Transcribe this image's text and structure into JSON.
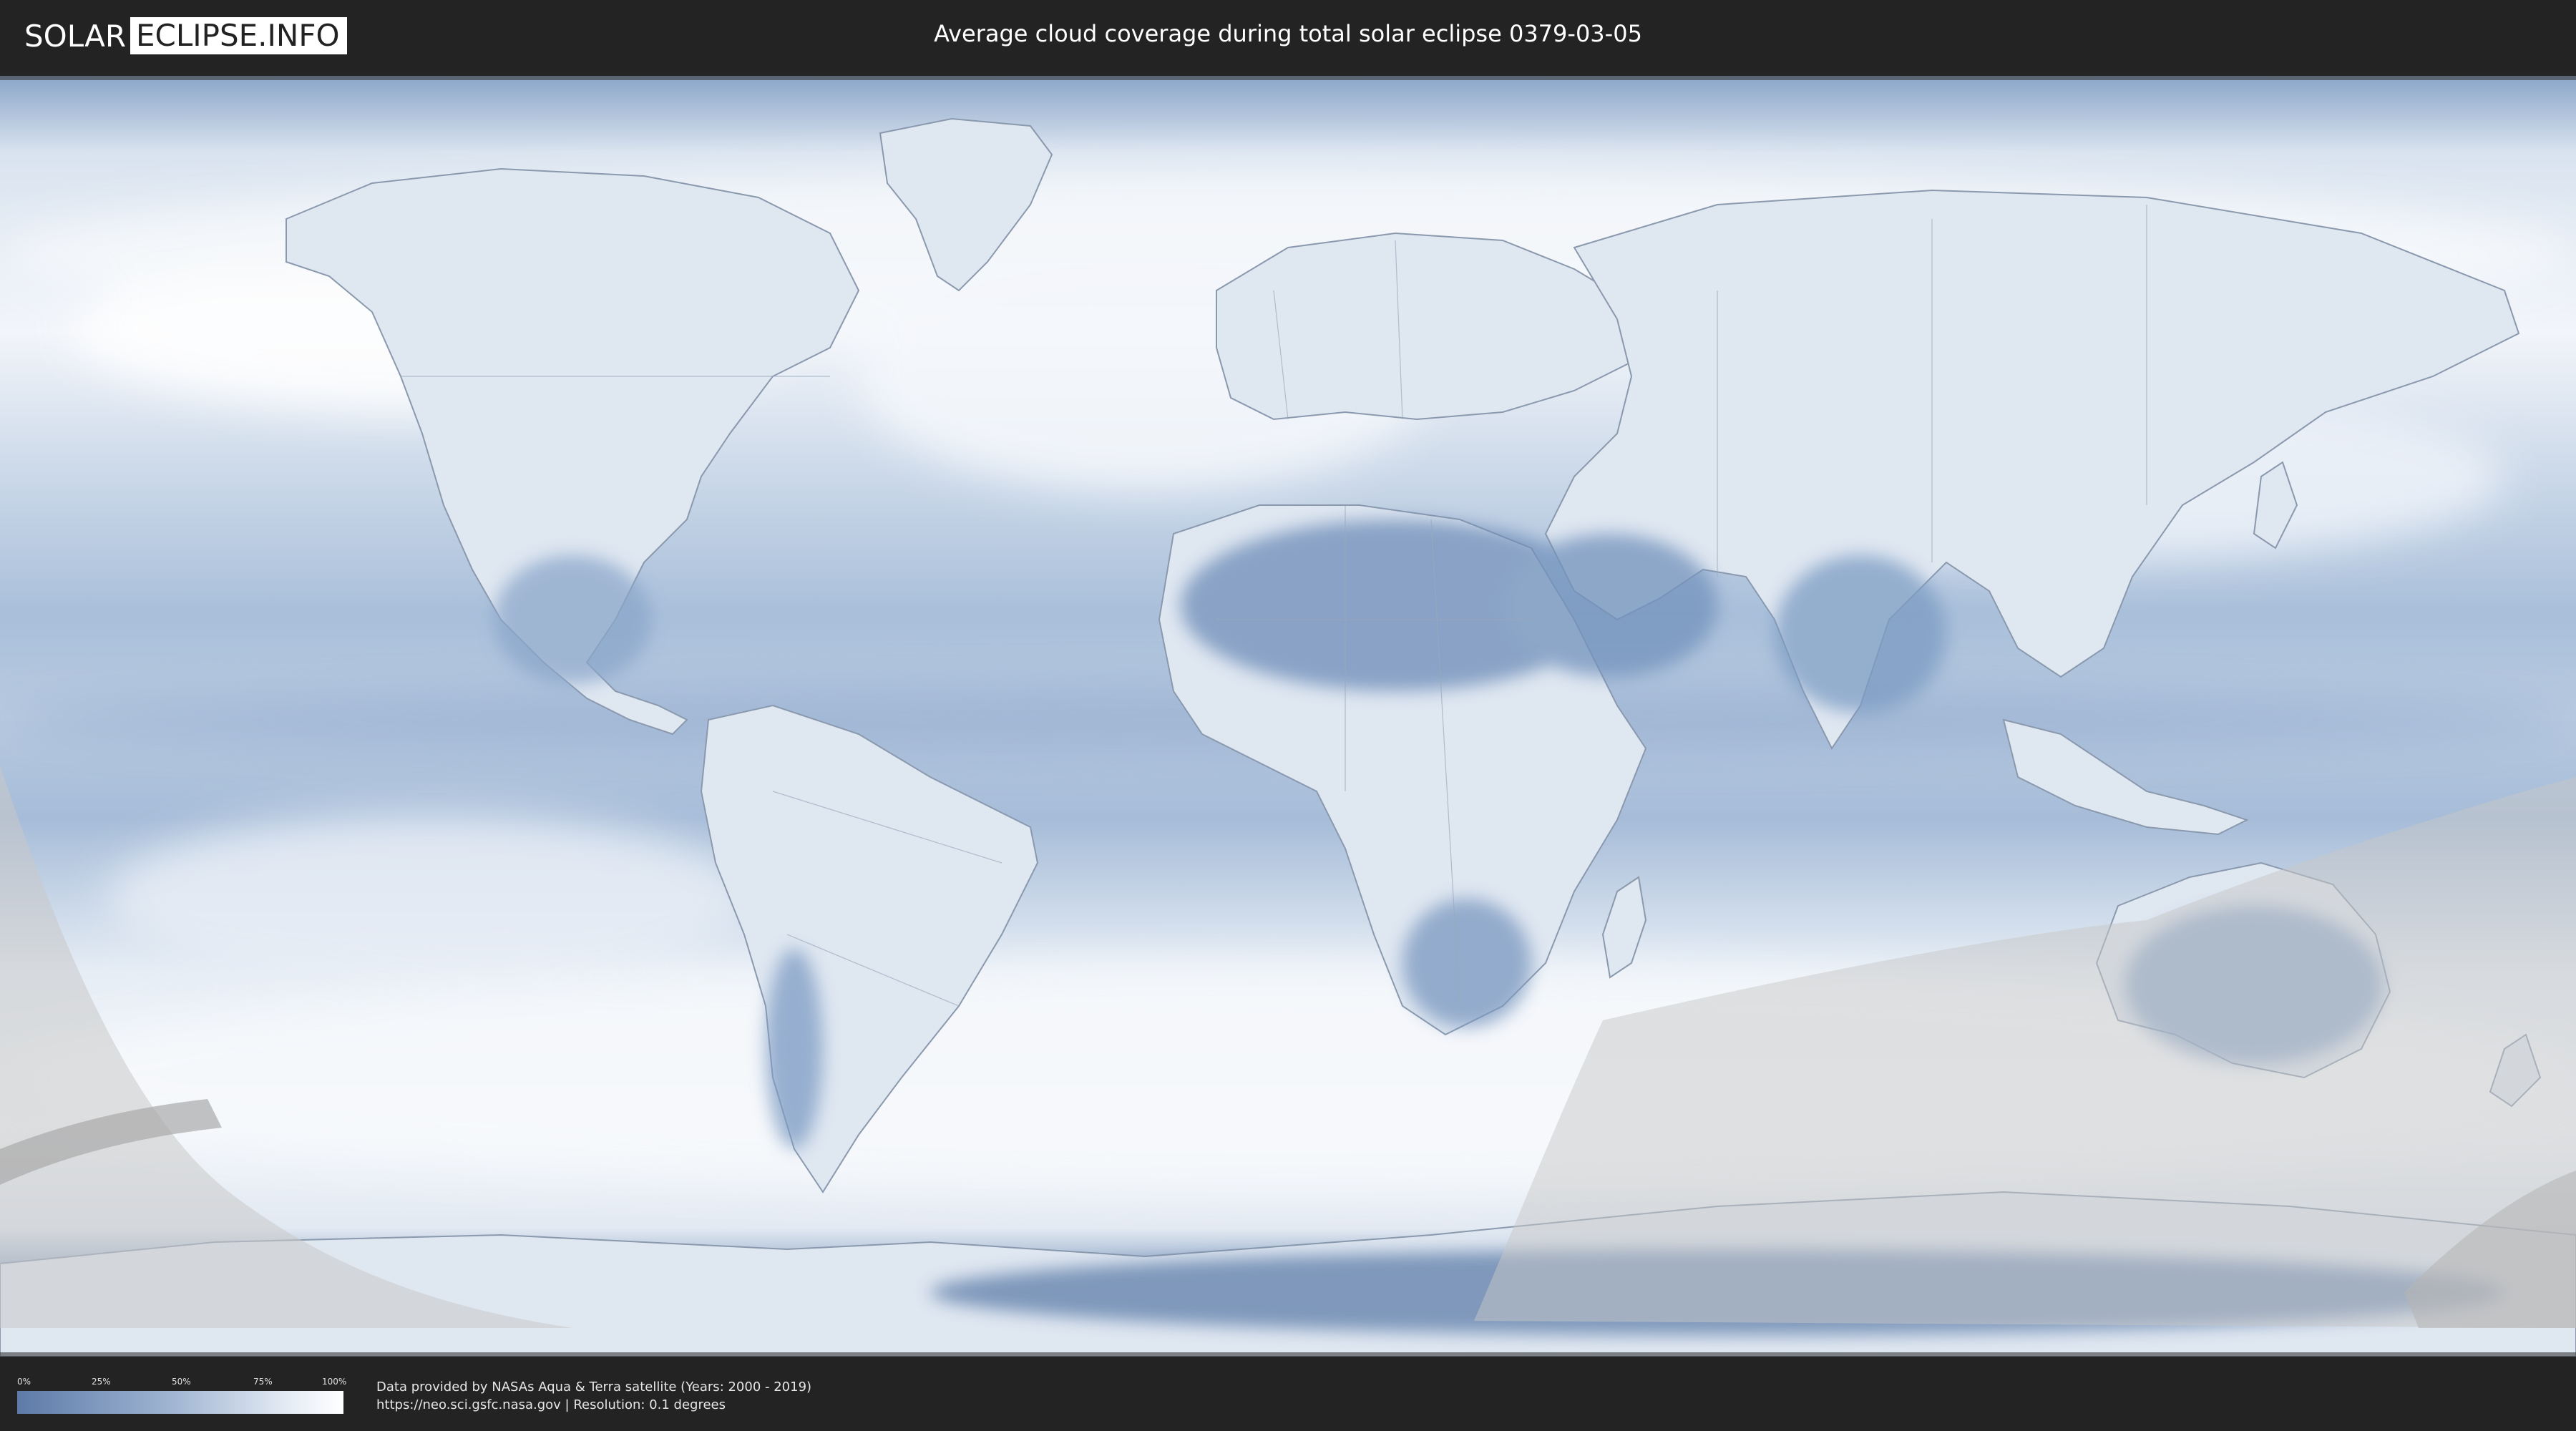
{
  "header": {
    "logo_left": "SOLAR",
    "logo_right": "ECLIPSE.INFO",
    "title": "Average cloud coverage during total solar eclipse 0379-03-05"
  },
  "legend": {
    "ticks": [
      "0%",
      "25%",
      "50%",
      "75%",
      "100%"
    ],
    "min_color": "#5d7aa8",
    "max_color": "#ffffff"
  },
  "footer": {
    "credit_line1": "Data provided by NASAs Aqua & Terra satellite (Years: 2000 - 2019)",
    "credit_line2": "https://neo.sci.gsfc.nasa.gov | Resolution: 0.1 degrees"
  },
  "colors": {
    "header_bg": "#232323",
    "cloud_clear": "#6f8fb8",
    "cloud_full": "#ffffff",
    "shadow_overlay": "#c8c8c8"
  }
}
